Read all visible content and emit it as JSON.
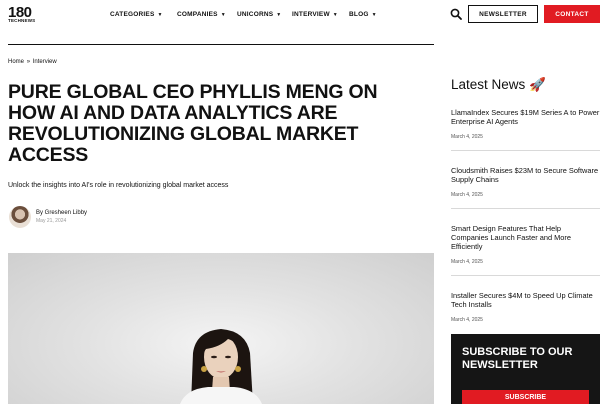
{
  "header": {
    "logo_main": "180",
    "logo_sub": "TECHNEWS",
    "nav": [
      {
        "label": "CATEGORIES"
      },
      {
        "label": "COMPANIES"
      },
      {
        "label": "UNICORNS"
      },
      {
        "label": "INTERVIEW"
      },
      {
        "label": "BLOG"
      }
    ],
    "newsletter_label": "NEWSLETTER",
    "contact_label": "CONTACT",
    "search_icon": "search-icon",
    "caret_icon": "caret-down-icon"
  },
  "breadcrumb": {
    "home": "Home",
    "separator": "»",
    "current": "Interview"
  },
  "article": {
    "title": "PURE GLOBAL CEO PHYLLIS MENG ON HOW AI AND DATA ANALYTICS ARE REVOLUTIONIZING GLOBAL MARKET ACCESS",
    "subtitle": "Unlock the insights into AI's role in revolutionizing global market access",
    "author": "By Gresheen Libby",
    "date": "May 21, 2024"
  },
  "sidebar": {
    "title": "Latest News 🚀",
    "items": [
      {
        "headline": "LlamaIndex Secures $19M Series A to Power Enterprise AI Agents",
        "date": "March 4, 2025"
      },
      {
        "headline": "Cloudsmith Raises $23M to Secure Software Supply Chains",
        "date": "March 4, 2025"
      },
      {
        "headline": "Smart Design Features That Help Companies Launch Faster and More Efficiently",
        "date": "March 4, 2025"
      },
      {
        "headline": "Installer Secures $4M to Speed Up Climate Tech Installs",
        "date": "March 4, 2025"
      }
    ],
    "subscribe_title": "SUBSCRIBE TO OUR NEWSLETTER",
    "subscribe_button": "SUBSCRIBE"
  },
  "colors": {
    "accent": "#e11b22",
    "dark_box": "#151515"
  }
}
